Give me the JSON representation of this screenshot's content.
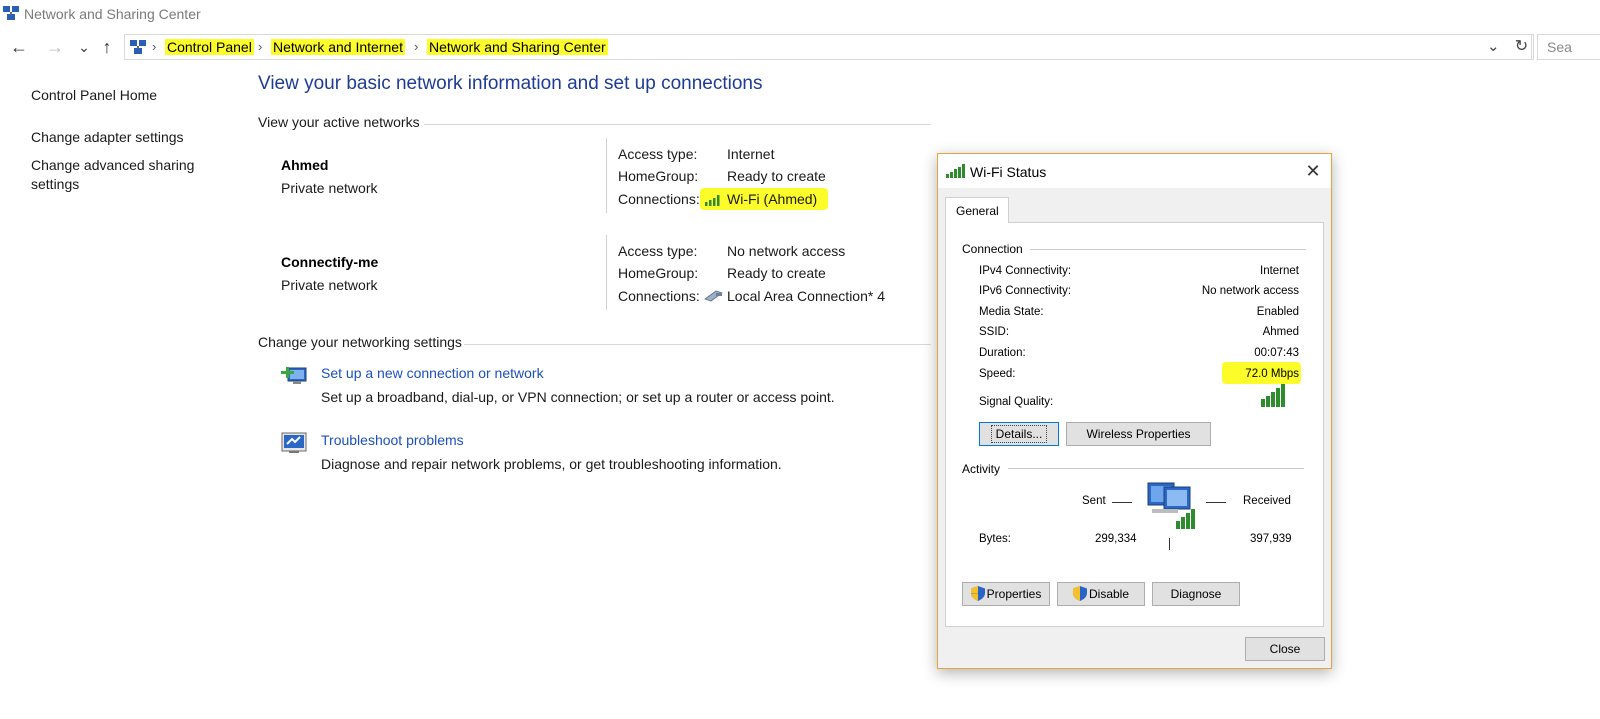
{
  "window": {
    "title": "Network and Sharing Center"
  },
  "nav": {
    "back": "←",
    "forward": "→",
    "recent": "⌄",
    "up": "↑"
  },
  "breadcrumb": [
    "Control Panel",
    "Network and Internet",
    "Network and Sharing Center"
  ],
  "address": {
    "dropdown": "⌄",
    "refresh": "↻",
    "search_placeholder": "Sea"
  },
  "sidebar": {
    "items": [
      {
        "label": "Control Panel Home"
      },
      {
        "label": "Change adapter settings"
      },
      {
        "label": "Change advanced sharing settings",
        "line1": "Change advanced sharing",
        "line2": "settings"
      }
    ]
  },
  "main": {
    "heading": "View your basic network information and set up connections",
    "active_networks_title": "View your active networks",
    "networks": [
      {
        "name": "Ahmed",
        "type": "Private network",
        "access_label": "Access type:",
        "access_value": "Internet",
        "homegroup_label": "HomeGroup:",
        "homegroup_value": "Ready to create",
        "connections_label": "Connections:",
        "connection_value": "Wi-Fi (Ahmed)",
        "connection_icon": "wifi-signal-icon"
      },
      {
        "name": "Connectify-me",
        "type": "Private network",
        "access_label": "Access type:",
        "access_value": "No network access",
        "homegroup_label": "HomeGroup:",
        "homegroup_value": "Ready to create",
        "connections_label": "Connections:",
        "connection_value": "Local Area Connection* 4",
        "connection_icon": "ethernet-cable-icon"
      }
    ],
    "settings_title": "Change your networking settings",
    "tasks": [
      {
        "link": "Set up a new connection or network",
        "desc": "Set up a broadband, dial-up, or VPN connection; or set up a router or access point.",
        "icon": "new-connection-icon"
      },
      {
        "link": "Troubleshoot problems",
        "desc": "Diagnose and repair network problems, or get troubleshooting information.",
        "icon": "troubleshoot-icon"
      }
    ]
  },
  "dialog": {
    "title": "Wi-Fi Status",
    "close_glyph": "✕",
    "tab": "General",
    "connection_title": "Connection",
    "rows": [
      {
        "label": "IPv4 Connectivity:",
        "value": "Internet"
      },
      {
        "label": "IPv6 Connectivity:",
        "value": "No network access"
      },
      {
        "label": "Media State:",
        "value": "Enabled"
      },
      {
        "label": "SSID:",
        "value": "Ahmed"
      },
      {
        "label": "Duration:",
        "value": "00:07:43"
      },
      {
        "label": "Speed:",
        "value": "72.0 Mbps"
      }
    ],
    "signal_label": "Signal Quality:",
    "signal_bars": 5,
    "details_button": "Details...",
    "wireless_button": "Wireless Properties",
    "activity_title": "Activity",
    "sent_label": "Sent",
    "received_label": "Received",
    "bytes_label": "Bytes:",
    "bytes_sent": "299,334",
    "bytes_received": "397,939",
    "properties_button": "Properties",
    "disable_button": "Disable",
    "diagnose_button": "Diagnose",
    "close_button": "Close"
  },
  "colors": {
    "highlight": "#fcfc2a",
    "link": "#1c4fbf",
    "heading": "#1e3c96",
    "dialog_border": "#e8a33d"
  }
}
